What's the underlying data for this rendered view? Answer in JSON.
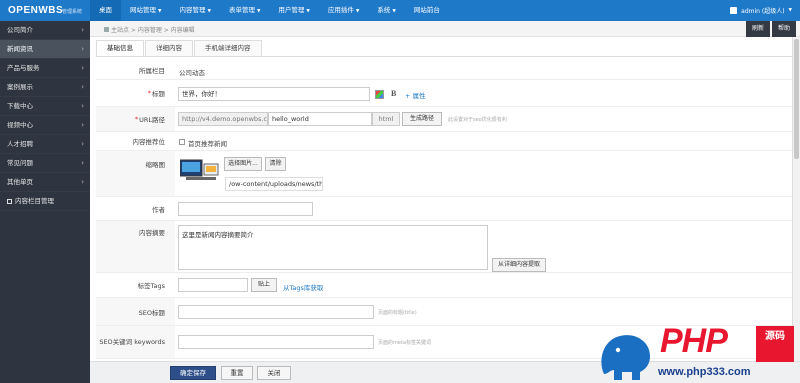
{
  "topbar": {
    "logo": "OPENWBS",
    "logo_sub": "管理系统",
    "nav": [
      {
        "label": "桌面",
        "active": true,
        "caret": false
      },
      {
        "label": "网站管理",
        "active": false,
        "caret": true
      },
      {
        "label": "内容管理",
        "active": false,
        "caret": true
      },
      {
        "label": "表单管理",
        "active": false,
        "caret": true
      },
      {
        "label": "用户管理",
        "active": false,
        "caret": true
      },
      {
        "label": "应用插件",
        "active": false,
        "caret": true
      },
      {
        "label": "系统",
        "active": false,
        "caret": true
      },
      {
        "label": "网站前台",
        "active": false,
        "caret": false
      }
    ],
    "user": "admin (超级人)"
  },
  "sidebar": {
    "items": [
      {
        "label": "公司简介",
        "active": false
      },
      {
        "label": "新闻资讯",
        "active": true
      },
      {
        "label": "产品与服务",
        "active": false
      },
      {
        "label": "案例展示",
        "active": false
      },
      {
        "label": "下载中心",
        "active": false
      },
      {
        "label": "视频中心",
        "active": false
      },
      {
        "label": "人才招聘",
        "active": false
      },
      {
        "label": "常见问题",
        "active": false
      },
      {
        "label": "其他单页",
        "active": false
      }
    ],
    "manage_label": "内容栏目管理"
  },
  "breadcrumb": "主站点 > 内容管理 > 内容编辑",
  "toolbar": {
    "refresh": "刷新",
    "help": "帮助"
  },
  "tabs": [
    {
      "label": "基础信息",
      "active": true
    },
    {
      "label": "详细内容",
      "active": false
    },
    {
      "label": "手机端详细内容",
      "active": false
    }
  ],
  "form": {
    "column": {
      "label": "所属栏目",
      "value": "公司动态"
    },
    "title": {
      "label": "标题",
      "value": "世界，你好！",
      "bold_icon": "B",
      "more_link": "+ 属性"
    },
    "url": {
      "label": "URL路径",
      "prefix": "http://v4.demo.openwbs.c",
      "value": "hello_world",
      "suffix": "html",
      "button": "生成路径",
      "hint": "此设置对于seo优化很有利"
    },
    "recommend": {
      "label": "内容推荐位",
      "option": "首页推荐新闻"
    },
    "thumbnail": {
      "label": "缩略图",
      "choose_button": "选择图片...",
      "clear_button": "清除",
      "path": "/ow-content/uploads/news/thu"
    },
    "author": {
      "label": "作者",
      "value": ""
    },
    "summary": {
      "label": "内容摘要",
      "value": "这里是新闻内容摘要简介",
      "extract_button": "从详细内容提取"
    },
    "tags": {
      "label": "标签Tags",
      "value": "",
      "paste_button": "贴上",
      "library_link": "从Tags库获取"
    },
    "seo_title": {
      "label": "SEO标题",
      "value": "",
      "hint": "页面的标题(title)"
    },
    "seo_keywords": {
      "label": "SEO关键词 keywords",
      "value": "",
      "hint": "页面的meta标签关键词"
    }
  },
  "bottom": {
    "save": "确定保存",
    "reset": "重置",
    "close": "关闭"
  },
  "watermark": {
    "brand": "PHP",
    "badge": "源码",
    "url": "www.php333.com"
  },
  "colors": {
    "topbar": "#1e79c8",
    "sidebar": "#2f3540",
    "primary_button": "#2e4e8a",
    "watermark_red": "#e8172f"
  }
}
